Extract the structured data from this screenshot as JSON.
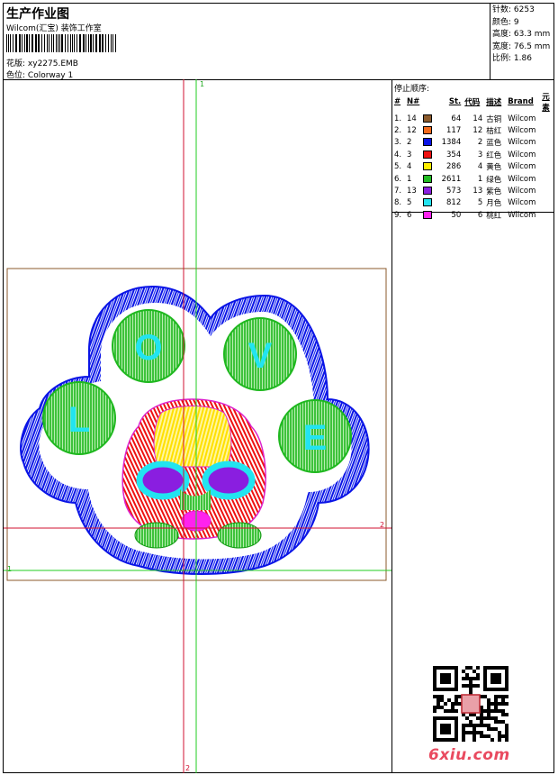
{
  "header": {
    "title": "生产作业图",
    "company": "Wilcom(汇宝) 装饰工作室",
    "design_label": "花版:",
    "design_value": "xy2275.EMB",
    "colorway_label": "色位:",
    "colorway_value": "Colorway 1"
  },
  "stats": {
    "stitches": "针数: 6253",
    "colors": "颜色: 9",
    "height": "高度: 63.3 mm",
    "width": "宽度: 76.5 mm",
    "scale": "比例: 1.86"
  },
  "stop_sequence": {
    "title": "停止顺序:",
    "headers": {
      "index": "#",
      "needle": "N#",
      "stitches": "St.",
      "code": "代码",
      "desc": "描述",
      "brand": "Brand",
      "element": "元素"
    },
    "rows": [
      {
        "index": "1.",
        "needle": "14",
        "color": "#8b5a2b",
        "stitches": "64",
        "code": "14",
        "desc": "古铜",
        "brand": "Wilcom"
      },
      {
        "index": "2.",
        "needle": "12",
        "color": "#f26a1b",
        "stitches": "117",
        "code": "12",
        "desc": "桔红",
        "brand": "Wilcom"
      },
      {
        "index": "3.",
        "needle": "2",
        "color": "#0a14e6",
        "stitches": "1384",
        "code": "2",
        "desc": "蓝色",
        "brand": "Wilcom"
      },
      {
        "index": "4.",
        "needle": "3",
        "color": "#ee1111",
        "stitches": "354",
        "code": "3",
        "desc": "红色",
        "brand": "Wilcom"
      },
      {
        "index": "5.",
        "needle": "4",
        "color": "#ffee00",
        "stitches": "286",
        "code": "4",
        "desc": "黄色",
        "brand": "Wilcom"
      },
      {
        "index": "6.",
        "needle": "1",
        "color": "#22bb22",
        "stitches": "2611",
        "code": "1",
        "desc": "绿色",
        "brand": "Wilcom"
      },
      {
        "index": "7.",
        "needle": "13",
        "color": "#8a1ee0",
        "stitches": "573",
        "code": "13",
        "desc": "紫色",
        "brand": "Wilcom"
      },
      {
        "index": "8.",
        "needle": "5",
        "color": "#22e4f0",
        "stitches": "812",
        "code": "5",
        "desc": "月色",
        "brand": "Wilcom"
      },
      {
        "index": "9.",
        "needle": "6",
        "color": "#ff22ee",
        "stitches": "50",
        "code": "6",
        "desc": "桃红",
        "brand": "Wilcom"
      }
    ]
  },
  "guides": {
    "label_1": "1",
    "label_2": "2"
  },
  "design_letters": {
    "l": "L",
    "o": "O",
    "v": "V",
    "e": "E"
  },
  "watermark": "6xiu.com",
  "colors": {
    "frame_box": "#8b5a2b",
    "guide_red": "#d01030",
    "guide_green": "#22cc22",
    "blue": "#0a14e6",
    "green": "#22bb22",
    "cyan": "#22e4f0",
    "watermark": "#e94a5f"
  }
}
